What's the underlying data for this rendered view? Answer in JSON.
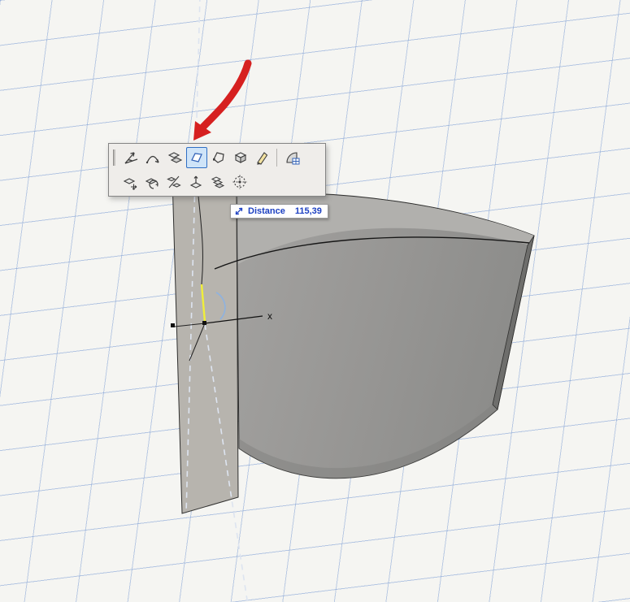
{
  "canvas": {
    "background": "#f5f5f2",
    "grid_color": "#9db8de",
    "axis": {
      "x_label": "x"
    },
    "model_name": "curved-wall-segment",
    "guide_style": "dashed"
  },
  "palette": {
    "selected_tool": "face-polygon-tool",
    "row1": [
      {
        "icon": "angle-arrow-tool-icon"
      },
      {
        "icon": "arc-tool-icon"
      },
      {
        "icon": "extrude-faces-tool-icon"
      },
      {
        "icon": "face-polygon-tool-icon",
        "selected": true
      },
      {
        "icon": "polygon-outline-tool-icon"
      },
      {
        "icon": "box-tool-icon"
      },
      {
        "icon": "pencil-tool-icon"
      },
      {
        "icon": "shell-grid-tool-icon"
      }
    ],
    "row2": [
      {
        "icon": "move-tool-icon"
      },
      {
        "icon": "rotate-tool-icon"
      },
      {
        "icon": "mirror-tool-icon"
      },
      {
        "icon": "elevate-tool-icon"
      },
      {
        "icon": "multiply-tool-icon"
      },
      {
        "icon": "gizmo-tool-icon"
      }
    ],
    "selection_color": "#2f6fc4"
  },
  "tooltip": {
    "icon": "diagonal-resize-arrow-icon",
    "label": "Distance",
    "value": "115,39",
    "text_color": "#1c40c2"
  },
  "annotation": {
    "arrow_color": "#d62020"
  }
}
